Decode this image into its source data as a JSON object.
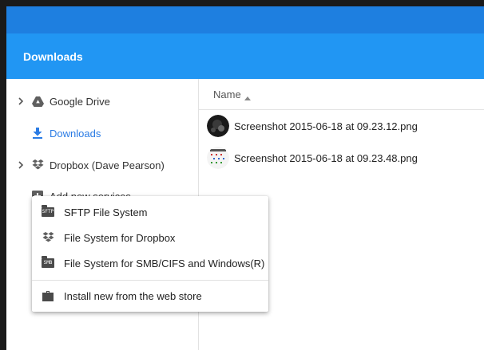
{
  "header": {
    "title": "Downloads"
  },
  "sidebar": {
    "items": [
      {
        "label": "Google Drive",
        "icon": "google-drive-icon",
        "expandable": true,
        "active": false
      },
      {
        "label": "Downloads",
        "icon": "download-icon",
        "expandable": false,
        "active": true
      },
      {
        "label": "Dropbox (Dave Pearson)",
        "icon": "dropbox-icon",
        "expandable": true,
        "active": false
      },
      {
        "label": "Add new services",
        "icon": "add-icon",
        "expandable": false,
        "active": false
      }
    ]
  },
  "file_list": {
    "column_header": "Name",
    "sort_direction": "ascending",
    "files": [
      {
        "name": "Screenshot 2015-06-18 at 09.23.12.png"
      },
      {
        "name": "Screenshot 2015-06-18 at 09.23.48.png"
      }
    ]
  },
  "services_menu": {
    "items": [
      {
        "label": "SFTP File System",
        "icon": "sftp-icon",
        "badge": "SFTP"
      },
      {
        "label": "File System for Dropbox",
        "icon": "dropbox-icon"
      },
      {
        "label": "File System for SMB/CIFS and Windows(R)",
        "icon": "smb-icon",
        "badge": "SMB"
      }
    ],
    "footer_item": {
      "label": "Install new from the web store",
      "icon": "briefcase-icon"
    }
  },
  "colors": {
    "header_blue": "#2196f3",
    "titlebar_blue": "#1e7fe0",
    "active_link": "#2a7be4"
  }
}
